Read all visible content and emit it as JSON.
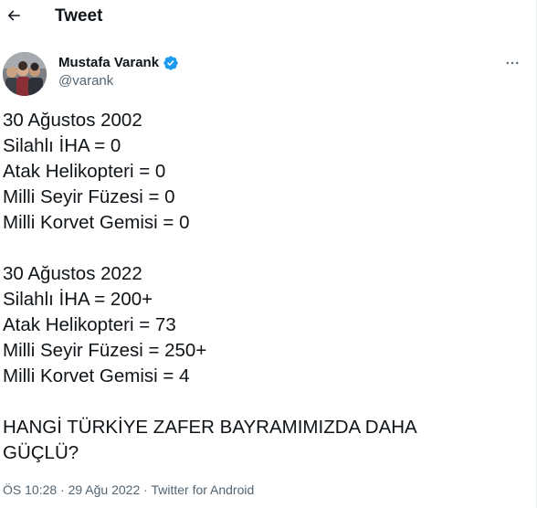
{
  "header": {
    "title": "Tweet",
    "back_icon": "arrow-left-icon"
  },
  "author": {
    "display_name": "Mustafa Varank",
    "handle": "@varank",
    "verified": true,
    "verified_color": "#1d9bf0"
  },
  "tweet": {
    "block1": [
      "30 Ağustos 2002",
      "Silahlı İHA = 0",
      "Atak Helikopteri = 0",
      "Milli Seyir Füzesi = 0",
      "Milli Korvet Gemisi = 0"
    ],
    "block2": [
      "30 Ağustos 2022",
      "Silahlı İHA = 200+",
      "Atak Helikopteri = 73",
      "Milli Seyir Füzesi = 250+",
      "Milli Korvet Gemisi = 4"
    ],
    "block3": [
      "HANGİ TÜRKİYE ZAFER BAYRAMIMIZDA DAHA",
      "GÜÇLÜ?"
    ]
  },
  "meta": {
    "time": "ÖS 10:28",
    "separator": " · ",
    "date": "29 Ağu 2022",
    "source": "Twitter for Android"
  },
  "colors": {
    "text": "#0f1419",
    "secondary": "#536471",
    "accent": "#1d9bf0"
  }
}
